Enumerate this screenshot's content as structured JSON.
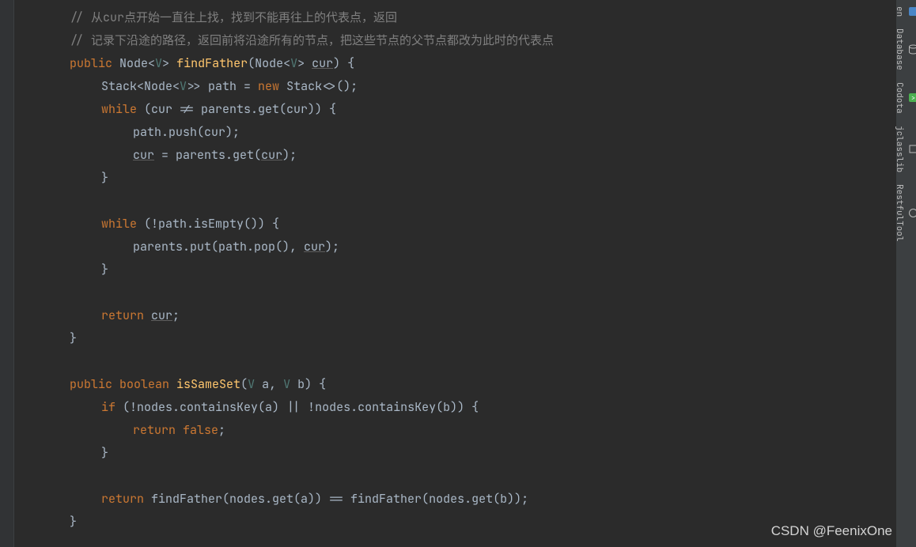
{
  "code": {
    "lines": [
      {
        "indent": 2,
        "tokens": [
          {
            "t": "// 从cur点开始一直往上找，找到不能再往上的代表点，返回",
            "c": "comment"
          }
        ]
      },
      {
        "indent": 2,
        "tokens": [
          {
            "t": "// 记录下沿途的路径，返回前将沿途所有的节点，把这些节点的父节点都改为此时的代表点",
            "c": "comment"
          }
        ]
      },
      {
        "indent": 2,
        "tokens": [
          {
            "t": "public ",
            "c": "keyword"
          },
          {
            "t": "Node<",
            "c": ""
          },
          {
            "t": "V",
            "c": "generic"
          },
          {
            "t": "> ",
            "c": ""
          },
          {
            "t": "findFather",
            "c": "method"
          },
          {
            "t": "(Node<",
            "c": ""
          },
          {
            "t": "V",
            "c": "generic"
          },
          {
            "t": "> ",
            "c": ""
          },
          {
            "t": "cur",
            "c": "underline"
          },
          {
            "t": ") {",
            "c": ""
          }
        ]
      },
      {
        "indent": 3,
        "tokens": [
          {
            "t": "Stack<Node<",
            "c": ""
          },
          {
            "t": "V",
            "c": "generic"
          },
          {
            "t": ">> path = ",
            "c": ""
          },
          {
            "t": "new ",
            "c": "keyword"
          },
          {
            "t": "Stack<>();",
            "c": ""
          }
        ]
      },
      {
        "indent": 3,
        "tokens": [
          {
            "t": "while ",
            "c": "keyword"
          },
          {
            "t": "(cur != ",
            "c": ""
          },
          {
            "t": "parents",
            "c": "param"
          },
          {
            "t": ".get(cur)) {",
            "c": ""
          }
        ]
      },
      {
        "indent": 4,
        "tokens": [
          {
            "t": "path.push(cur);",
            "c": ""
          }
        ]
      },
      {
        "indent": 4,
        "tokens": [
          {
            "t": "cur",
            "c": "underline"
          },
          {
            "t": " = ",
            "c": ""
          },
          {
            "t": "parents",
            "c": "param"
          },
          {
            "t": ".get(",
            "c": ""
          },
          {
            "t": "cur",
            "c": "underline"
          },
          {
            "t": ");",
            "c": ""
          }
        ]
      },
      {
        "indent": 3,
        "tokens": [
          {
            "t": "}",
            "c": ""
          }
        ]
      },
      {
        "indent": 3,
        "tokens": []
      },
      {
        "indent": 3,
        "tokens": [
          {
            "t": "while ",
            "c": "keyword"
          },
          {
            "t": "(!path.isEmpty()) {",
            "c": ""
          }
        ]
      },
      {
        "indent": 4,
        "tokens": [
          {
            "t": "parents",
            "c": "param"
          },
          {
            "t": ".put(path.pop(), ",
            "c": ""
          },
          {
            "t": "cur",
            "c": "underline"
          },
          {
            "t": ");",
            "c": ""
          }
        ]
      },
      {
        "indent": 3,
        "tokens": [
          {
            "t": "}",
            "c": ""
          }
        ]
      },
      {
        "indent": 3,
        "tokens": []
      },
      {
        "indent": 3,
        "tokens": [
          {
            "t": "return ",
            "c": "keyword"
          },
          {
            "t": "cur",
            "c": "underline"
          },
          {
            "t": ";",
            "c": ""
          }
        ]
      },
      {
        "indent": 2,
        "tokens": [
          {
            "t": "}",
            "c": ""
          }
        ]
      },
      {
        "indent": 2,
        "tokens": []
      },
      {
        "indent": 2,
        "tokens": [
          {
            "t": "public ",
            "c": "keyword"
          },
          {
            "t": "boolean ",
            "c": "keyword"
          },
          {
            "t": "isSameSet",
            "c": "method"
          },
          {
            "t": "(",
            "c": ""
          },
          {
            "t": "V ",
            "c": "generic"
          },
          {
            "t": "a, ",
            "c": ""
          },
          {
            "t": "V ",
            "c": "generic"
          },
          {
            "t": "b) {",
            "c": ""
          }
        ]
      },
      {
        "indent": 3,
        "tokens": [
          {
            "t": "if ",
            "c": "keyword"
          },
          {
            "t": "(!",
            "c": ""
          },
          {
            "t": "nodes",
            "c": "param"
          },
          {
            "t": ".containsKey(a) || !",
            "c": ""
          },
          {
            "t": "nodes",
            "c": "param"
          },
          {
            "t": ".containsKey(b)) {",
            "c": ""
          }
        ]
      },
      {
        "indent": 4,
        "tokens": [
          {
            "t": "return false",
            "c": "keyword"
          },
          {
            "t": ";",
            "c": ""
          }
        ]
      },
      {
        "indent": 3,
        "tokens": [
          {
            "t": "}",
            "c": ""
          }
        ]
      },
      {
        "indent": 3,
        "tokens": []
      },
      {
        "indent": 3,
        "tokens": [
          {
            "t": "return ",
            "c": "keyword"
          },
          {
            "t": "findFather(",
            "c": ""
          },
          {
            "t": "nodes",
            "c": "param"
          },
          {
            "t": ".get(a)) == findFather(",
            "c": ""
          },
          {
            "t": "nodes",
            "c": "param"
          },
          {
            "t": ".get(b));",
            "c": ""
          }
        ]
      },
      {
        "indent": 2,
        "tokens": [
          {
            "t": "}",
            "c": ""
          }
        ]
      }
    ]
  },
  "sidebar": {
    "tabs": [
      {
        "icon": "M",
        "label": "en",
        "color": "#4a86c7"
      },
      {
        "icon": "db",
        "label": "Database",
        "color": "#8a8a8a"
      },
      {
        "icon": "co",
        "label": "Codota",
        "color": "#4caf50"
      },
      {
        "icon": "j",
        "label": "jclasslib",
        "color": "#8a8a8a"
      },
      {
        "icon": "r",
        "label": "RestfulTool",
        "color": "#8a8a8a"
      }
    ]
  },
  "watermark": "CSDN @FeenixOne"
}
